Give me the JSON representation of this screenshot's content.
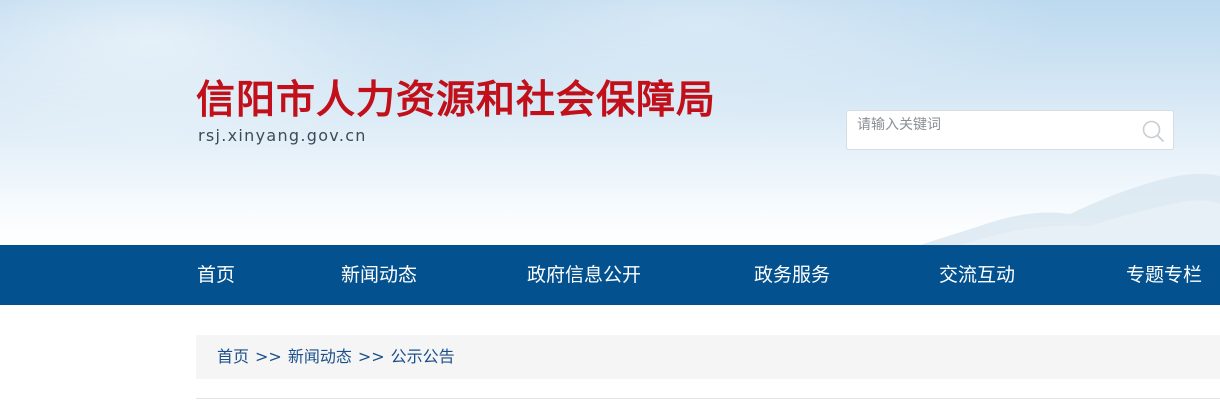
{
  "header": {
    "title": "信阳市人力资源和社会保障局",
    "domain": "rsj.xinyang.gov.cn",
    "title_color": "#c1101a"
  },
  "search": {
    "placeholder": "请输入关键词",
    "value": "",
    "button_icon": "search-icon"
  },
  "nav": {
    "background_color": "#04518f",
    "items": [
      {
        "label": "首页"
      },
      {
        "label": "新闻动态"
      },
      {
        "label": "政府信息公开"
      },
      {
        "label": "政务服务"
      },
      {
        "label": "交流互动"
      },
      {
        "label": "专题专栏"
      }
    ]
  },
  "breadcrumb": {
    "items": [
      {
        "label": "首页"
      },
      {
        "label": "新闻动态"
      },
      {
        "label": "公示公告"
      }
    ],
    "separator": ">>"
  }
}
